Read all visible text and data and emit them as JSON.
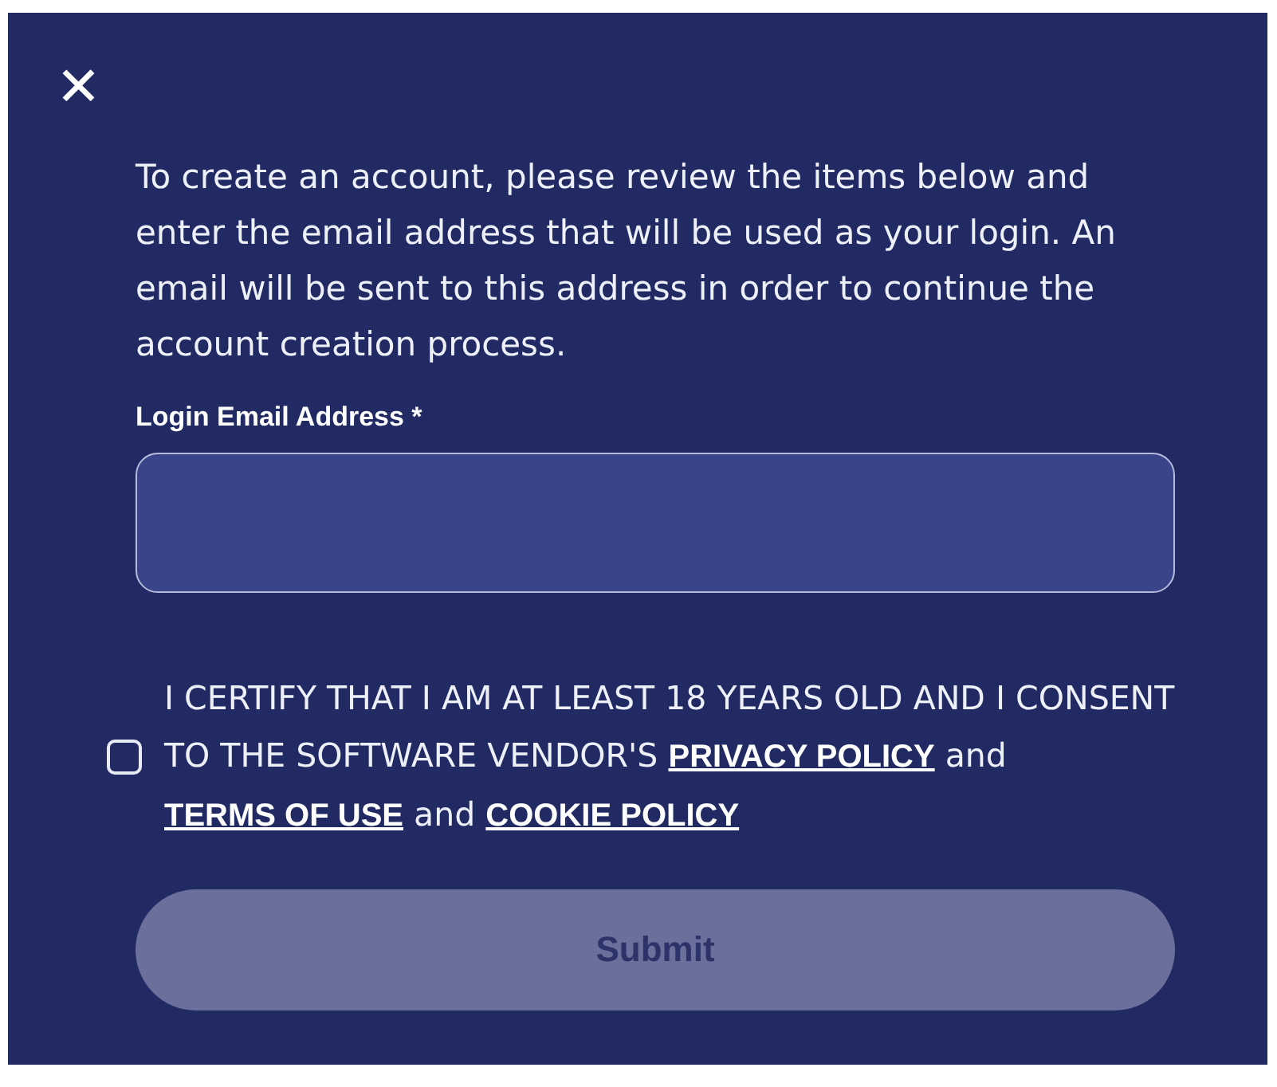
{
  "close_button": {
    "label": "✕"
  },
  "intro": "To create an account, please review the items below and enter the email address that will be used as your login. An email will be sent to this address in order to continue the account creation process.",
  "email_field": {
    "label": "Login Email Address *"
  },
  "consent": {
    "checked": false,
    "parts": [
      {
        "kind": "text",
        "text": "I CERTIFY THAT I AM AT LEAST 18 YEARS OLD AND I CONSENT TO THE SOFTWARE VENDOR'S"
      },
      {
        "kind": "link",
        "text": "PRIVACY POLICY"
      },
      {
        "kind": "text",
        "text": "and"
      },
      {
        "kind": "link",
        "text": "TERMS OF USE"
      },
      {
        "kind": "text",
        "text": "and"
      },
      {
        "kind": "link",
        "text": "COOKIE POLICY"
      }
    ]
  },
  "submit_button": {
    "label": "Submit",
    "disabled": true
  }
}
